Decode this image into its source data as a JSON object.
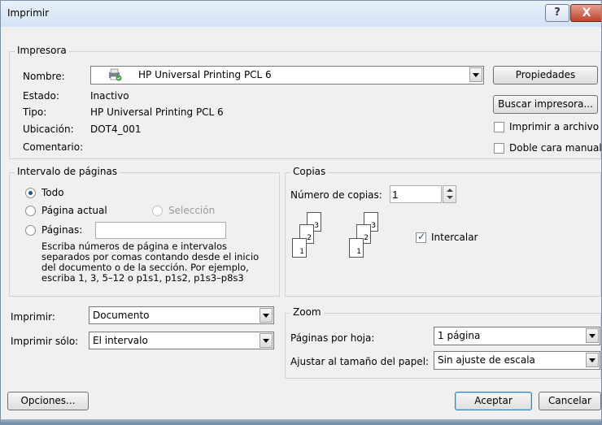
{
  "window": {
    "title": "Imprimir",
    "help_label": "?",
    "close_label": "X"
  },
  "printer": {
    "group_label": "Impresora",
    "name_label": "Nombre:",
    "name_value": "HP Universal Printing PCL 6",
    "status_label": "Estado:",
    "status_value": "Inactivo",
    "type_label": "Tipo:",
    "type_value": "HP Universal Printing PCL 6",
    "location_label": "Ubicación:",
    "location_value": "DOT4_001",
    "comment_label": "Comentario:",
    "properties_button": "Propiedades",
    "find_printer_button": "Buscar impresora...",
    "print_to_file_label": "Imprimir a archivo",
    "print_to_file_checked": false,
    "manual_duplex_label": "Doble cara manual",
    "manual_duplex_checked": false
  },
  "page_range": {
    "group_label": "Intervalo de páginas",
    "all_label": "Todo",
    "selected": "all",
    "current_page_label": "Página actual",
    "selection_label": "Selección",
    "pages_label": "Páginas:",
    "pages_value": "",
    "help_text": "Escriba números de página e intervalos separados por comas contando desde el inicio del documento o de la sección. Por ejemplo, escriba 1, 3, 5–12 o p1s1, p1s2, p1s3–p8s3"
  },
  "copies": {
    "group_label": "Copias",
    "count_label": "Número de copias:",
    "count_value": "1",
    "collate_label": "Intercalar",
    "collate_checked": true,
    "icon_pages": [
      "1",
      "2",
      "3"
    ]
  },
  "print_what": {
    "label": "Imprimir:",
    "value": "Documento"
  },
  "print_only": {
    "label": "Imprimir sólo:",
    "value": "El intervalo"
  },
  "zoom": {
    "group_label": "Zoom",
    "pages_per_sheet_label": "Páginas por hoja:",
    "pages_per_sheet_value": "1 página",
    "scale_label": "Ajustar al tamaño del papel:",
    "scale_value": "Sin ajuste de escala"
  },
  "footer": {
    "options_button": "Opciones...",
    "ok_button": "Aceptar",
    "cancel_button": "Cancelar"
  }
}
